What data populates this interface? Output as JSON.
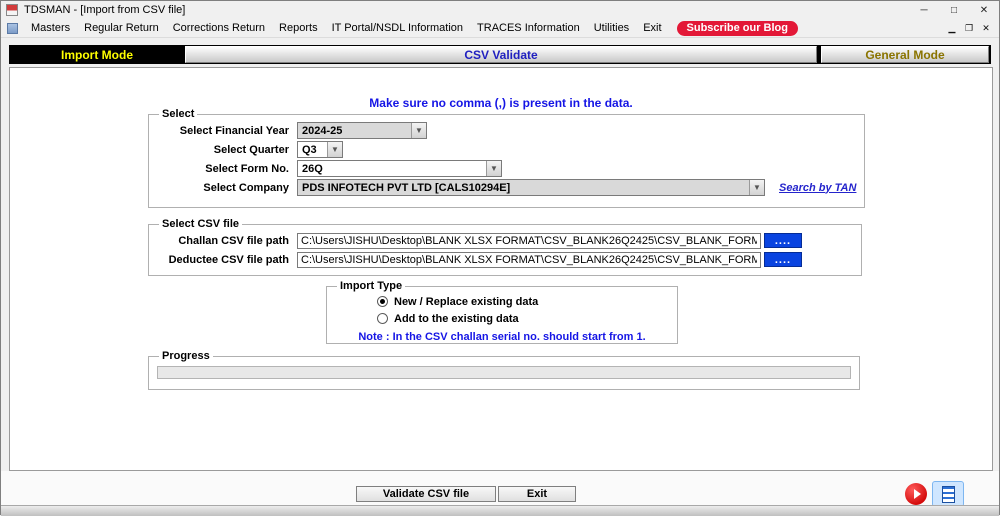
{
  "window": {
    "title": "TDSMAN - [Import from CSV file]",
    "icons": {
      "minimize": "─",
      "maximize": "□",
      "close": "✕"
    }
  },
  "menubar": {
    "items": [
      {
        "label": "Masters"
      },
      {
        "label": "Regular Return"
      },
      {
        "label": "Corrections Return"
      },
      {
        "label": "Reports"
      },
      {
        "label": "IT Portal/NSDL Information"
      },
      {
        "label": "TRACES Information"
      },
      {
        "label": "Utilities"
      },
      {
        "label": "Exit"
      }
    ],
    "subscribe_label": "Subscribe our Blog",
    "mdi": {
      "minimize": "▁",
      "restore": "❐",
      "close": "✕"
    }
  },
  "modebar": {
    "import_mode": "Import Mode",
    "csv_validate": "CSV Validate",
    "general_mode": "General Mode"
  },
  "main": {
    "warning": "Make sure no comma (,) is present in the data.",
    "select_group": {
      "title": "Select",
      "financial_year": {
        "label": "Select Financial Year",
        "value": "2024-25"
      },
      "quarter": {
        "label": "Select Quarter",
        "value": "Q3"
      },
      "form_no": {
        "label": "Select Form No.",
        "value": "26Q"
      },
      "company": {
        "label": "Select Company",
        "value": "PDS INFOTECH PVT LTD [CALS10294E]"
      },
      "search_link": "Search by TAN"
    },
    "csv_group": {
      "title": "Select CSV file",
      "challan": {
        "label": "Challan CSV file path",
        "value": "C:\\Users\\JISHU\\Desktop\\BLANK XLSX FORMAT\\CSV_BLANK26Q2425\\CSV_BLANK_FORM/"
      },
      "deductee": {
        "label": "Deductee CSV file path",
        "value": "C:\\Users\\JISHU\\Desktop\\BLANK XLSX FORMAT\\CSV_BLANK26Q2425\\CSV_BLANK_FORM/"
      },
      "browse_label": "...."
    },
    "import_type": {
      "title": "Import Type",
      "options": [
        {
          "label": "New / Replace existing data",
          "selected": true
        },
        {
          "label": "Add to the existing data",
          "selected": false
        }
      ],
      "note": "Note : In the CSV challan serial no. should start from 1."
    },
    "progress": {
      "label": "Progress",
      "percent": 0
    }
  },
  "footer": {
    "validate_label": "Validate CSV file",
    "exit_label": "Exit"
  },
  "colors": {
    "mode_yellow": "#ffff00",
    "csv_validate_blue": "#2020c0",
    "warning_blue": "#1515e5",
    "subscribe_red": "#e31837",
    "browse_button_blue": "#0a44e0"
  }
}
